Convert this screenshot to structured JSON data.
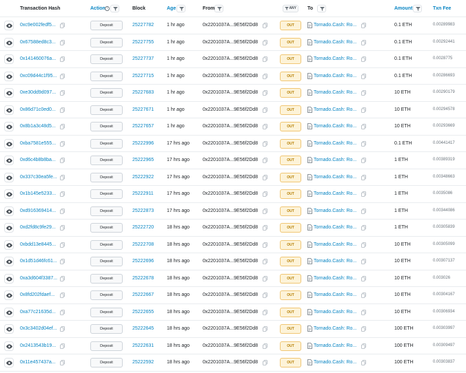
{
  "columns": {
    "tx_hash": "Transaction Hash",
    "action": "Action",
    "block": "Block",
    "age": "Age",
    "from": "From",
    "any": "ANY",
    "to": "To",
    "amount": "Amount",
    "txn_fee": "Txn Fee"
  },
  "colors": {
    "link": "#0784c3",
    "out_bg": "#fdf3d8",
    "out_border": "#f0c674",
    "out_text": "#b47d00"
  },
  "rows": [
    {
      "hash": "0xc9e002fedf5...",
      "action": "Deposit",
      "block": "25227782",
      "age": "1 hr ago",
      "from": "0x2201037A...9E56f2Dd8",
      "dir": "OUT",
      "to": "Tornado.Cash: Ro...",
      "amount": "0.1 ETH",
      "fee": "0.00289983"
    },
    {
      "hash": "0x67588ed8c3...",
      "action": "Deposit",
      "block": "25227755",
      "age": "1 hr ago",
      "from": "0x2201037A...9E56f2Dd8",
      "dir": "OUT",
      "to": "Tornado.Cash: Ro...",
      "amount": "0.1 ETH",
      "fee": "0.00292441"
    },
    {
      "hash": "0x141460076a...",
      "action": "Deposit",
      "block": "25227737",
      "age": "1 hr ago",
      "from": "0x2201037A...9E56f2Dd8",
      "dir": "OUT",
      "to": "Tornado.Cash: Ro...",
      "amount": "0.1 ETH",
      "fee": "0.0028775"
    },
    {
      "hash": "0xc09d44c1f95...",
      "action": "Deposit",
      "block": "25227715",
      "age": "1 hr ago",
      "from": "0x2201037A...9E56f2Dd8",
      "dir": "OUT",
      "to": "Tornado.Cash: Ro...",
      "amount": "0.1 ETH",
      "fee": "0.00286693"
    },
    {
      "hash": "0xe30dd9d097...",
      "action": "Deposit",
      "block": "25227683",
      "age": "1 hr ago",
      "from": "0x2201037A...9E56f2Dd8",
      "dir": "OUT",
      "to": "Tornado.Cash: Ro...",
      "amount": "10 ETH",
      "fee": "0.00290179"
    },
    {
      "hash": "0x86d71c0ed0...",
      "action": "Deposit",
      "block": "25227671",
      "age": "1 hr ago",
      "from": "0x2201037A...9E56f2Dd8",
      "dir": "OUT",
      "to": "Tornado.Cash: Ro...",
      "amount": "10 ETH",
      "fee": "0.00294578"
    },
    {
      "hash": "0x8b1a3c48d5...",
      "action": "Deposit",
      "block": "25227657",
      "age": "1 hr ago",
      "from": "0x2201037A...9E56f2Dd8",
      "dir": "OUT",
      "to": "Tornado.Cash: Ro...",
      "amount": "10 ETH",
      "fee": "0.00293669"
    },
    {
      "hash": "0xba7581e555...",
      "action": "Deposit",
      "block": "25222996",
      "age": "17 hrs ago",
      "from": "0x2201037A...9E56f2Dd8",
      "dir": "OUT",
      "to": "Tornado.Cash: Ro...",
      "amount": "0.1 ETH",
      "fee": "0.00441417"
    },
    {
      "hash": "0xd6c4b8b8ba...",
      "action": "Deposit",
      "block": "25222965",
      "age": "17 hrs ago",
      "from": "0x2201037A...9E56f2Dd8",
      "dir": "OUT",
      "to": "Tornado.Cash: Ro...",
      "amount": "1 ETH",
      "fee": "0.00389319"
    },
    {
      "hash": "0x337c30ea5fe...",
      "action": "Deposit",
      "block": "25222922",
      "age": "17 hrs ago",
      "from": "0x2201037A...9E56f2Dd8",
      "dir": "OUT",
      "to": "Tornado.Cash: Ro...",
      "amount": "1 ETH",
      "fee": "0.00348663"
    },
    {
      "hash": "0x1b145e5233...",
      "action": "Deposit",
      "block": "25222911",
      "age": "17 hrs ago",
      "from": "0x2201037A...9E56f2Dd8",
      "dir": "OUT",
      "to": "Tornado.Cash: Ro...",
      "amount": "1 ETH",
      "fee": "0.0035086"
    },
    {
      "hash": "0xd916369414...",
      "action": "Deposit",
      "block": "25222873",
      "age": "17 hrs ago",
      "from": "0x2201037A...9E56f2Dd8",
      "dir": "OUT",
      "to": "Tornado.Cash: Ro...",
      "amount": "1 ETH",
      "fee": "0.00344086"
    },
    {
      "hash": "0xd2fd8c9fe29...",
      "action": "Deposit",
      "block": "25222720",
      "age": "18 hrs ago",
      "from": "0x2201037A...9E56f2Dd8",
      "dir": "OUT",
      "to": "Tornado.Cash: Ro...",
      "amount": "1 ETH",
      "fee": "0.00305839"
    },
    {
      "hash": "0xbdd13e8445...",
      "action": "Deposit",
      "block": "25222708",
      "age": "18 hrs ago",
      "from": "0x2201037A...9E56f2Dd8",
      "dir": "OUT",
      "to": "Tornado.Cash: Ro...",
      "amount": "10 ETH",
      "fee": "0.00305099"
    },
    {
      "hash": "0x1d51d46fc61...",
      "action": "Deposit",
      "block": "25222696",
      "age": "18 hrs ago",
      "from": "0x2201037A...9E56f2Dd8",
      "dir": "OUT",
      "to": "Tornado.Cash: Ro...",
      "amount": "10 ETH",
      "fee": "0.00307137"
    },
    {
      "hash": "0xa3d604f3387...",
      "action": "Deposit",
      "block": "25222678",
      "age": "18 hrs ago",
      "from": "0x2201037A...9E56f2Dd8",
      "dir": "OUT",
      "to": "Tornado.Cash: Ro...",
      "amount": "10 ETH",
      "fee": "0.003026"
    },
    {
      "hash": "0x8fd202fdaef...",
      "action": "Deposit",
      "block": "25222667",
      "age": "18 hrs ago",
      "from": "0x2201037A...9E56f2Dd8",
      "dir": "OUT",
      "to": "Tornado.Cash: Ro...",
      "amount": "10 ETH",
      "fee": "0.00304167"
    },
    {
      "hash": "0xa77c21635d...",
      "action": "Deposit",
      "block": "25222655",
      "age": "18 hrs ago",
      "from": "0x2201037A...9E56f2Dd8",
      "dir": "OUT",
      "to": "Tornado.Cash: Ro...",
      "amount": "10 ETH",
      "fee": "0.00306934"
    },
    {
      "hash": "0x3c3402d04ef...",
      "action": "Deposit",
      "block": "25222645",
      "age": "18 hrs ago",
      "from": "0x2201037A...9E56f2Dd8",
      "dir": "OUT",
      "to": "Tornado.Cash: Ro...",
      "amount": "100 ETH",
      "fee": "0.00303997"
    },
    {
      "hash": "0x2413543b19...",
      "action": "Deposit",
      "block": "25222631",
      "age": "18 hrs ago",
      "from": "0x2201037A...9E56f2Dd8",
      "dir": "OUT",
      "to": "Tornado.Cash: Ro...",
      "amount": "100 ETH",
      "fee": "0.00309497"
    },
    {
      "hash": "0x11e457437a...",
      "action": "Deposit",
      "block": "25222592",
      "age": "18 hrs ago",
      "from": "0x2201037A...9E56f2Dd8",
      "dir": "OUT",
      "to": "Tornado.Cash: Ro...",
      "amount": "100 ETH",
      "fee": "0.00303837"
    }
  ]
}
